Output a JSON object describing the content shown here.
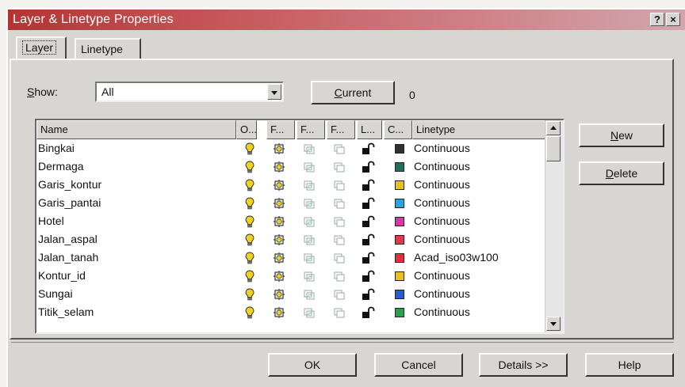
{
  "window": {
    "title": "Layer & Linetype Properties",
    "help_button": "?",
    "close_button": "×"
  },
  "tabs": [
    {
      "label": "Layer",
      "active": true
    },
    {
      "label": "Linetype",
      "active": false
    }
  ],
  "show": {
    "label_u": "S",
    "label_rest": "how:",
    "value": "All"
  },
  "current": {
    "button_u": "C",
    "button_rest": "urrent",
    "value": "0"
  },
  "columns": [
    "Name",
    "O...",
    "F...",
    "F...",
    "F...",
    "L...",
    "C...",
    "Linetype"
  ],
  "layers": [
    {
      "name": "Bingkai",
      "color": "#303030",
      "linetype": "Continuous"
    },
    {
      "name": "Dermaga",
      "color": "#1f6f5a",
      "linetype": "Continuous"
    },
    {
      "name": "Garis_kontur",
      "color": "#e8c21a",
      "linetype": "Continuous"
    },
    {
      "name": "Garis_pantai",
      "color": "#2aa3e0",
      "linetype": "Continuous"
    },
    {
      "name": "Hotel",
      "color": "#d63aa0",
      "linetype": "Continuous"
    },
    {
      "name": "Jalan_aspal",
      "color": "#e23a4a",
      "linetype": "Continuous"
    },
    {
      "name": "Jalan_tanah",
      "color": "#e0303c",
      "linetype": "Acad_iso03w100"
    },
    {
      "name": "Kontur_id",
      "color": "#e8c21a",
      "linetype": "Continuous"
    },
    {
      "name": "Sungai",
      "color": "#2a5bd0",
      "linetype": "Continuous"
    },
    {
      "name": "Titik_selam",
      "color": "#2aa04a",
      "linetype": "Continuous"
    }
  ],
  "buttons": {
    "new_u": "N",
    "new_rest": "ew",
    "delete_u": "D",
    "delete_rest": "elete",
    "ok": "OK",
    "cancel": "Cancel",
    "details": "Details >>",
    "help": "Help"
  },
  "icons": {
    "on": "lightbulb-on-icon",
    "freeze": "sun-thawed-icon",
    "freeze_vp": "freeze-viewport-icon",
    "freeze_new": "freeze-new-viewport-icon",
    "lock": "padlock-unlocked-icon"
  },
  "colors": {
    "title_start": "#b43434",
    "title_end": "#d2a6ad",
    "face": "#d8d6d2",
    "bulb": "#f0d21e",
    "sun": "#e8d020"
  }
}
